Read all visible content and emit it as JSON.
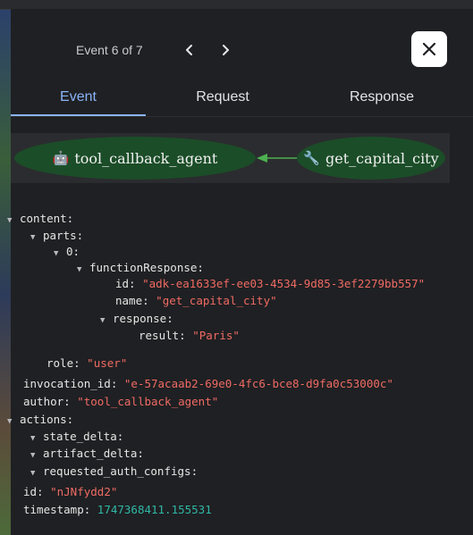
{
  "nav": {
    "event_label": "Event 6 of 7"
  },
  "tabs": [
    {
      "label": "Event",
      "active": true
    },
    {
      "label": "Request",
      "active": false
    },
    {
      "label": "Response",
      "active": false
    }
  ],
  "graph": {
    "source_node": "tool_callback_agent",
    "source_icon": "robot-icon",
    "target_node": "get_capital_city",
    "target_icon": "wrench-icon",
    "edge_color": "#4caf50",
    "node_color": "#1b4d28"
  },
  "event": {
    "content_key": "content:",
    "parts_key": "parts:",
    "index_key": "0:",
    "function_response_key": "functionResponse:",
    "id_key": "id:",
    "id_value": "\"adk-ea1633ef-ee03-4534-9d85-3ef2279bb557\"",
    "name_key": "name:",
    "name_value": "\"get_capital_city\"",
    "response_key": "response:",
    "result_key": "result:",
    "result_value": "\"Paris\"",
    "role_key": "role:",
    "role_value": "\"user\"",
    "invocation_id_key": "invocation_id:",
    "invocation_id_value": "\"e-57acaab2-69e0-4fc6-bce8-d9fa0c53000c\"",
    "author_key": "author:",
    "author_value": "\"tool_callback_agent\"",
    "actions_key": "actions:",
    "state_delta_key": "state_delta:",
    "artifact_delta_key": "artifact_delta:",
    "requested_auth_configs_key": "requested_auth_configs:",
    "event_id_key": "id:",
    "event_id_value": "\"nJNfydd2\"",
    "timestamp_key": "timestamp:",
    "timestamp_value": "1747368411.155531"
  },
  "colors": {
    "accent": "#8ab4f8",
    "string": "#ef6b63",
    "number": "#2fb8a6"
  }
}
